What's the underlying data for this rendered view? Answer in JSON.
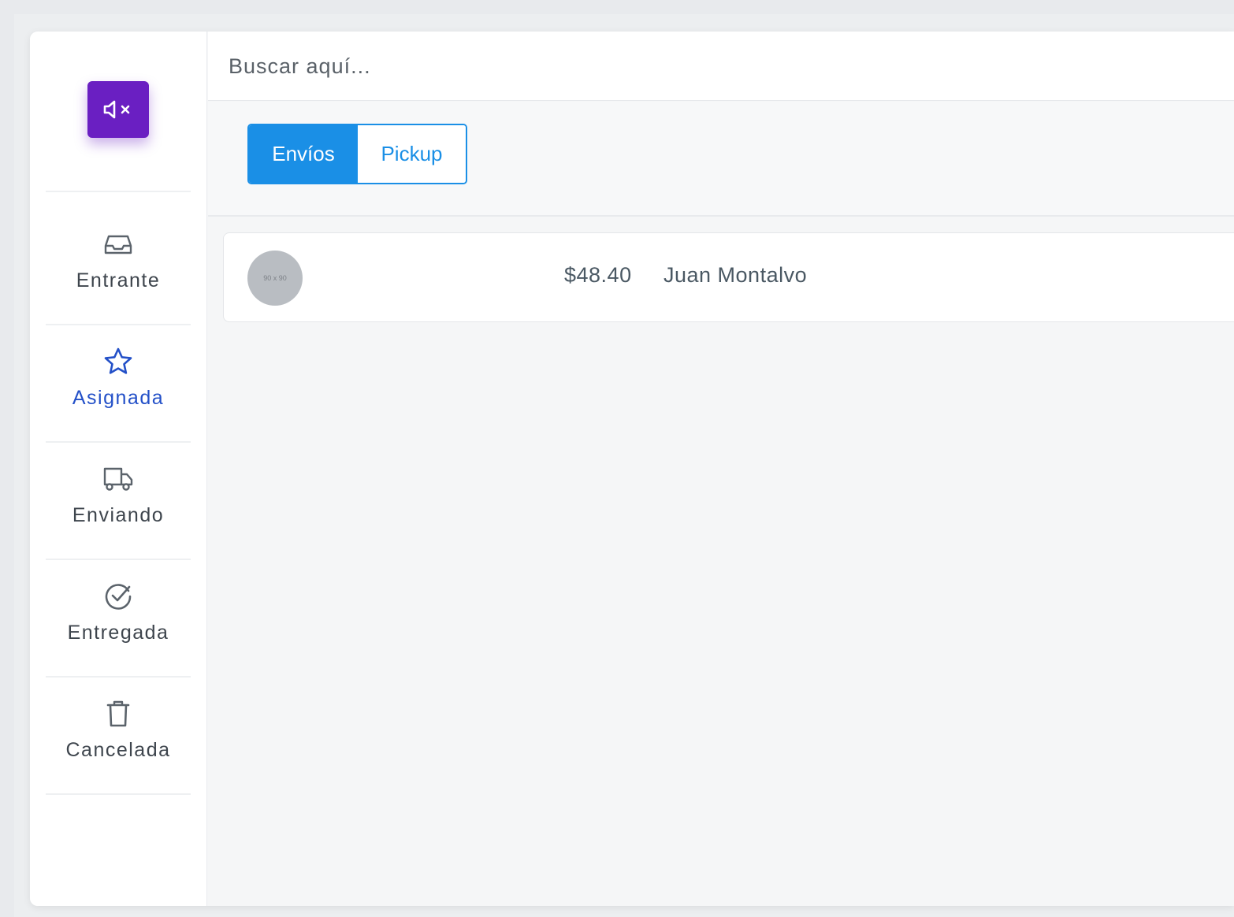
{
  "sidebar": {
    "mute_button": {
      "icon": "speaker-muted-icon",
      "color": "#6a1fc2"
    },
    "items": [
      {
        "label": "Entrante",
        "icon": "inbox-icon",
        "active": false
      },
      {
        "label": "Asignada",
        "icon": "star-icon",
        "active": true
      },
      {
        "label": "Enviando",
        "icon": "truck-icon",
        "active": false
      },
      {
        "label": "Entregada",
        "icon": "check-circle-icon",
        "active": false
      },
      {
        "label": "Cancelada",
        "icon": "trash-icon",
        "active": false
      }
    ]
  },
  "search": {
    "placeholder": "Buscar aquí...",
    "value": ""
  },
  "tabs": {
    "items": [
      {
        "label": "Envíos",
        "selected": true
      },
      {
        "label": "Pickup",
        "selected": false
      }
    ],
    "accent": "#1a8fe6"
  },
  "orders": [
    {
      "avatar_text": "90 x 90",
      "amount": "$48.40",
      "customer": "Juan Montalvo"
    }
  ],
  "colors": {
    "active_nav": "#2350c8",
    "text": "#3e454d"
  }
}
